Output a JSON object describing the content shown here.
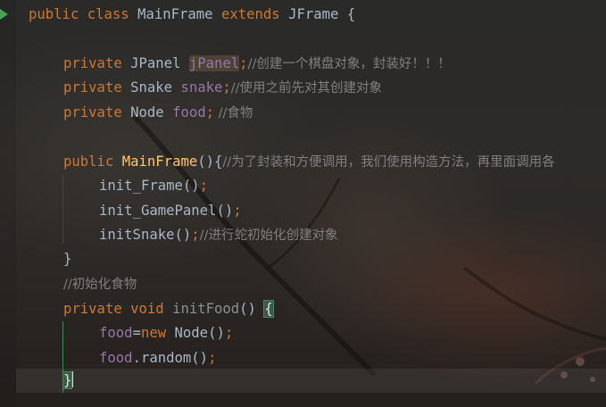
{
  "editor": {
    "lines": [
      {
        "id": "class-decl",
        "tokens": [
          "public",
          " class ",
          "MainFrame",
          " extends ",
          "JFrame",
          " {"
        ]
      },
      {
        "id": "field-jpanel",
        "tokens": [
          "private",
          " JPanel ",
          "jPanel",
          ";",
          "//创建一个棋盘对象，封装好！！！"
        ]
      },
      {
        "id": "field-snake",
        "tokens": [
          "private",
          " Snake ",
          "snake",
          ";",
          "//使用之前先对其创建对象"
        ]
      },
      {
        "id": "field-food",
        "tokens": [
          "private",
          " Node ",
          "food",
          ";",
          " //食物"
        ]
      },
      {
        "id": "constructor",
        "tokens": [
          "public",
          " ",
          "MainFrame",
          "(){",
          "//为了封装和方便调用，我们使用构造方法，再里面调用各"
        ]
      },
      {
        "id": "call-init-frame",
        "tokens": [
          "init_Frame",
          "()",
          ";"
        ]
      },
      {
        "id": "call-init-gamepanel",
        "tokens": [
          "init_GamePanel",
          "()",
          ";"
        ]
      },
      {
        "id": "call-init-snake",
        "tokens": [
          "initSnake",
          "()",
          ";",
          "//进行蛇初始化创建对象"
        ]
      },
      {
        "id": "constructor-close",
        "tokens": [
          "}"
        ]
      },
      {
        "id": "comment-init-food",
        "tokens": [
          "//初始化食物"
        ]
      },
      {
        "id": "method-init-food",
        "tokens": [
          "private",
          " ",
          "void",
          " ",
          "initFood",
          "() ",
          "{"
        ]
      },
      {
        "id": "assign-food",
        "tokens": [
          "food",
          "=",
          "new",
          " Node",
          "()",
          ";"
        ]
      },
      {
        "id": "food-random",
        "tokens": [
          "food",
          ".random",
          "()",
          ";"
        ]
      },
      {
        "id": "method-close",
        "tokens": [
          "}"
        ]
      }
    ]
  },
  "colors": {
    "keyword": "#cc7832",
    "field": "#9876aa",
    "method_decl": "#ffc66d",
    "plain": "#a9b7c6",
    "comment": "#808080",
    "run_gutter": "#4aa44f"
  },
  "icons": {
    "run_gutter": "run-arrow-icon"
  }
}
